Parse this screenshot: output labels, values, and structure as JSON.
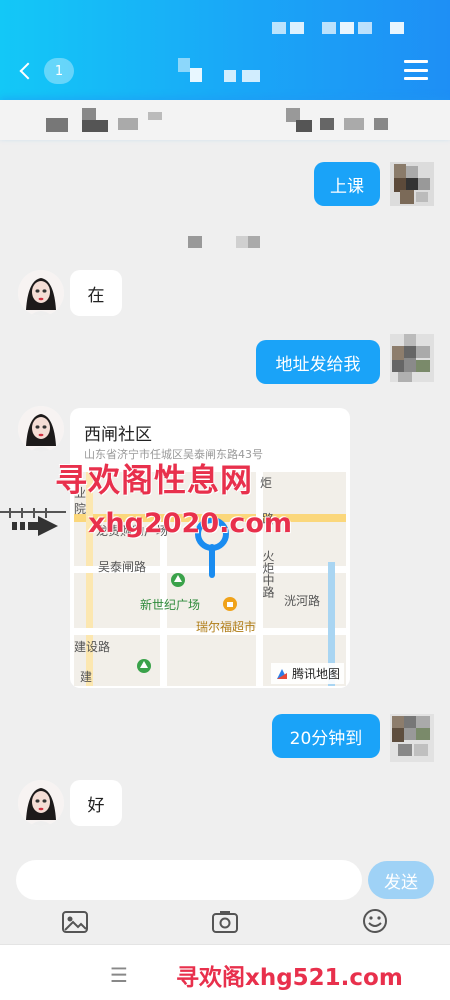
{
  "header": {
    "unread_badge": "1"
  },
  "messages": [
    {
      "side": "out",
      "text": "上课"
    },
    {
      "side": "in",
      "text": "在"
    },
    {
      "side": "out",
      "text": "地址发给我"
    },
    {
      "side": "in",
      "type": "location",
      "title": "西闸社区",
      "address": "山东省济宁市任城区吴泰闸东路43号",
      "map": {
        "labels": [
          "吴泰闸路",
          "新世纪广场",
          "瑞尔福超市",
          "洸河路",
          "火炬中路",
          "建设路",
          "建",
          "炬",
          "路",
          "业",
          "院",
          "龙贵购物广场"
        ],
        "provider": "腾讯地图"
      }
    },
    {
      "side": "out",
      "text": "20分钟到"
    },
    {
      "side": "in",
      "text": "好"
    }
  ],
  "watermarks": [
    "寻欢阁性息网",
    "xhg2020.com",
    "寻欢阁xhg521.com"
  ],
  "composer": {
    "input_value": "",
    "send_label": "发送"
  },
  "toolbar": {
    "icons": [
      "photo-icon",
      "camera-icon",
      "emoji-icon"
    ]
  },
  "nav": {
    "menu_glyph": "☰"
  },
  "colors": {
    "header_start": "#13c8f7",
    "header_end": "#1e8ff5",
    "bubble_out": "#1aa3f8",
    "send_button": "#9fd2f6",
    "watermark": "#e8304c"
  }
}
